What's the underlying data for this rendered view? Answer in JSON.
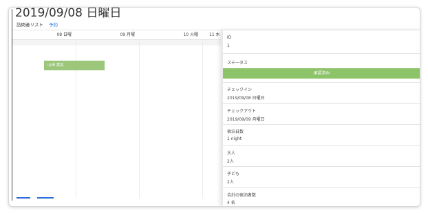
{
  "header": {
    "title": "2019/09/08 日曜日"
  },
  "tabs": [
    {
      "label": "訪問者リスト"
    },
    {
      "label": "予約"
    }
  ],
  "calendar": {
    "days": [
      "08 日曜",
      "09 月曜",
      "10 火曜",
      "11 水"
    ],
    "event": {
      "label": "山田 貴気"
    }
  },
  "detail": {
    "id_label": "ID",
    "id_value": "1",
    "status_label": "ステータス",
    "status_value": "承認済み",
    "checkin_label": "チェックイン",
    "checkin_value": "2019/09/08 日曜日",
    "checkout_label": "チェックアウト",
    "checkout_value": "2019/09/09 月曜日",
    "nights_label": "宿泊日数",
    "nights_value": "1 night",
    "adults_label": "大人",
    "adults_value": "2人",
    "children_label": "子ども",
    "children_value": "2人",
    "total_label": "合計の宿泊者数",
    "total_value": "4 名"
  },
  "colors": {
    "accent": "#2a7ae2",
    "event": "#9cc67a",
    "status": "#8dc46a"
  }
}
